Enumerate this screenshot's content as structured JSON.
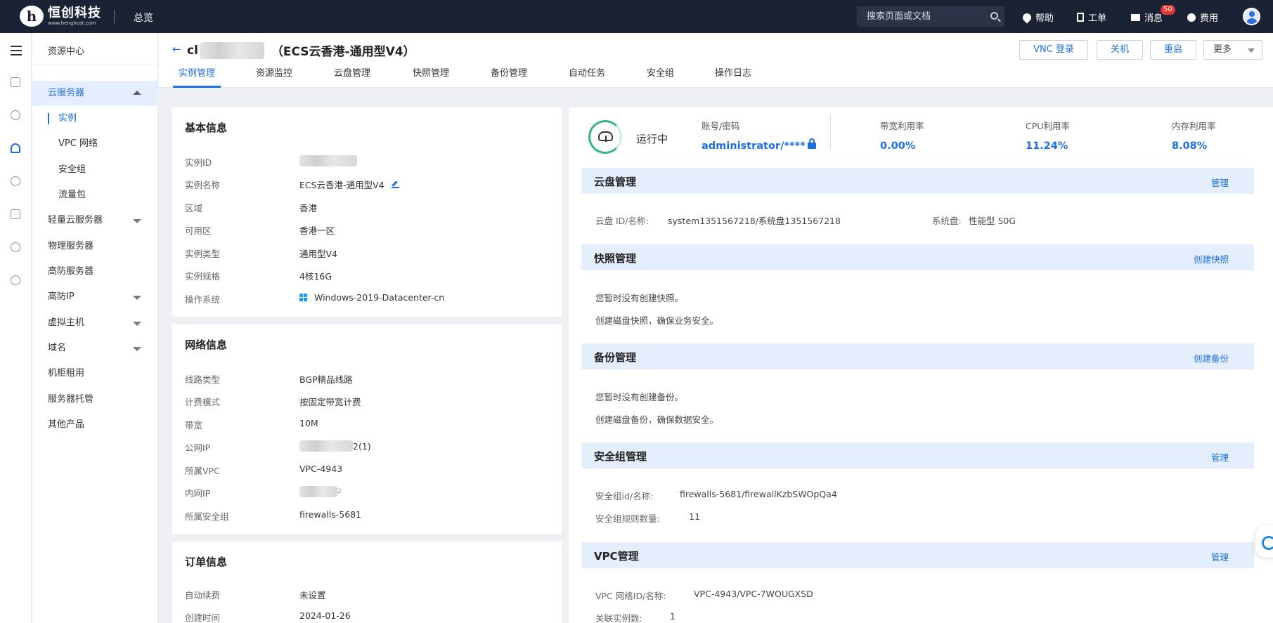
{
  "topbar": {
    "logo_mark": "h",
    "logo_name": "恒创科技",
    "logo_url": "www.henghost.com",
    "overview": "总览",
    "search_placeholder": "搜索页面或文档",
    "help": "帮助",
    "ticket": "工单",
    "messages": "消息",
    "messages_badge": "50",
    "fees": "费用"
  },
  "iconbar": {
    "icons": [
      "menu-icon",
      "scan-icon",
      "user-icon",
      "cloud-server-icon",
      "currency-icon",
      "document-icon",
      "cube-icon",
      "chat-icon"
    ]
  },
  "sidenav": {
    "resource_center": "资源中心",
    "cloud_server": "云服务器",
    "sub_items": [
      "实例",
      "VPC 网络",
      "安全组",
      "流量包"
    ],
    "items": [
      "轻量云服务器",
      "物理服务器",
      "高防服务器",
      "高防IP",
      "虚拟主机",
      "域名",
      "机柜租用",
      "服务器托管",
      "其他产品"
    ]
  },
  "header": {
    "back": "←",
    "title_prefix": "cl",
    "title_suffix": "（ECS云香港-通用型V4）",
    "buttons": {
      "vnc": "VNC 登录",
      "shutdown": "关机",
      "restart": "重启",
      "more": "更多"
    },
    "tabs": [
      "实例管理",
      "资源监控",
      "云盘管理",
      "快照管理",
      "备份管理",
      "自动任务",
      "安全组",
      "操作日志"
    ]
  },
  "basic_info": {
    "title": "基本信息",
    "rows": [
      {
        "label": "实例ID",
        "value": ""
      },
      {
        "label": "实例名称",
        "value": "ECS云香港-通用型V4"
      },
      {
        "label": "区域",
        "value": "香港"
      },
      {
        "label": "可用区",
        "value": "香港一区"
      },
      {
        "label": "实例类型",
        "value": "通用型V4"
      },
      {
        "label": "实例规格",
        "value": "4核16G"
      },
      {
        "label": "操作系统",
        "value": "Windows-2019-Datacenter-cn"
      }
    ]
  },
  "network_info": {
    "title": "网络信息",
    "rows": [
      {
        "label": "线路类型",
        "value": "BGP精品线路"
      },
      {
        "label": "计费模式",
        "value": "按固定带宽计费"
      },
      {
        "label": "带宽",
        "value": "10M"
      },
      {
        "label": "公网IP",
        "value": "2(1)"
      },
      {
        "label": "所属VPC",
        "value": "VPC-4943"
      },
      {
        "label": "内网IP",
        "value": "2"
      },
      {
        "label": "所属安全组",
        "value": "firewalls-5681"
      }
    ]
  },
  "order_info": {
    "title": "订单信息",
    "rows": [
      {
        "label": "自动续费",
        "value": "未设置"
      },
      {
        "label": "创建时间",
        "value": "2024-01-26"
      }
    ]
  },
  "status": {
    "state": "运行中",
    "account_label": "账号/密码",
    "account_value": "administrator/****",
    "bandwidth_label": "带宽利用率",
    "bandwidth_value": "0.00%",
    "cpu_label": "CPU利用率",
    "cpu_value": "11.24%",
    "memory_label": "内存利用率",
    "memory_value": "8.08%",
    "state_color": "#35b879"
  },
  "sections": {
    "disk": {
      "title": "云盘管理",
      "link": "管理",
      "id_label": "云盘 ID/名称:",
      "id_value": "system1351567218/系统盘1351567218",
      "sys_label": "系统盘:",
      "sys_value": "性能型 50G"
    },
    "snapshot": {
      "title": "快照管理",
      "link": "创建快照",
      "line1": "您暂时没有创建快照。",
      "line2": "创建磁盘快照，确保业务安全。"
    },
    "backup": {
      "title": "备份管理",
      "link": "创建备份",
      "line1": "您暂时没有创建备份。",
      "line2": "创建磁盘备份，确保数据安全。"
    },
    "security": {
      "title": "安全组管理",
      "link": "管理",
      "id_label": "安全组id/名称:",
      "id_value": "firewalls-5681/firewallKzbSWOpQa4",
      "count_label": "安全组规则数量:",
      "count_value": "11"
    },
    "vpc": {
      "title": "VPC管理",
      "link": "管理",
      "id_label": "VPC 网络ID/名称:",
      "id_value": "VPC-4943/VPC-7WOUGXSD",
      "count_label": "关联实例数:",
      "count_value": "1"
    }
  },
  "colors": {
    "accent": "#1d6fe0",
    "topbar": "#1b2233",
    "section_bg": "#e4eefd",
    "badge": "#e53535"
  }
}
